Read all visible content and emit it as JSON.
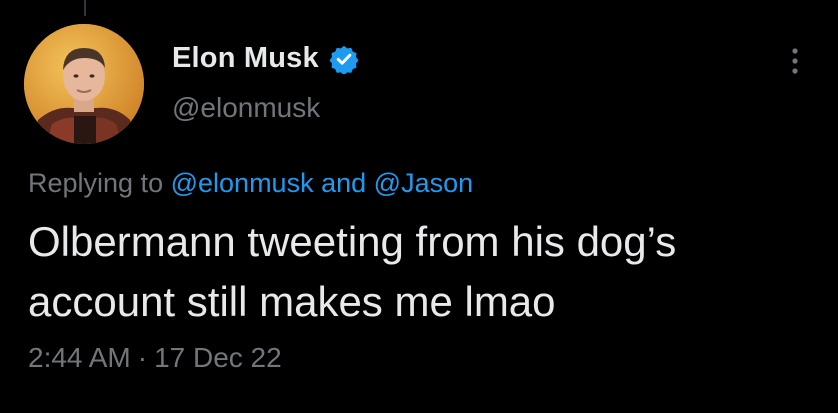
{
  "tweet": {
    "author": {
      "display_name": "Elon Musk",
      "handle": "@elonmusk",
      "verified": true,
      "avatar_icon": "profile-photo"
    },
    "replying": {
      "prefix": "Replying to",
      "mention_1": "@elonmusk",
      "conjunction": "and",
      "mention_2": "@Jason"
    },
    "text_line_1": "Olbermann tweeting from his dog’s",
    "text_line_2": "account still makes me lmao",
    "time": "2:44 AM",
    "separator": "·",
    "date": "17 Dec 22"
  },
  "colors": {
    "background": "#000000",
    "primary_text": "#e7e9ea",
    "secondary_text": "#71767b",
    "link": "#1d9bf0",
    "verified_badge": "#1d9bf0"
  },
  "icons": {
    "verified": "verified-badge-icon",
    "more": "more-options-icon"
  }
}
